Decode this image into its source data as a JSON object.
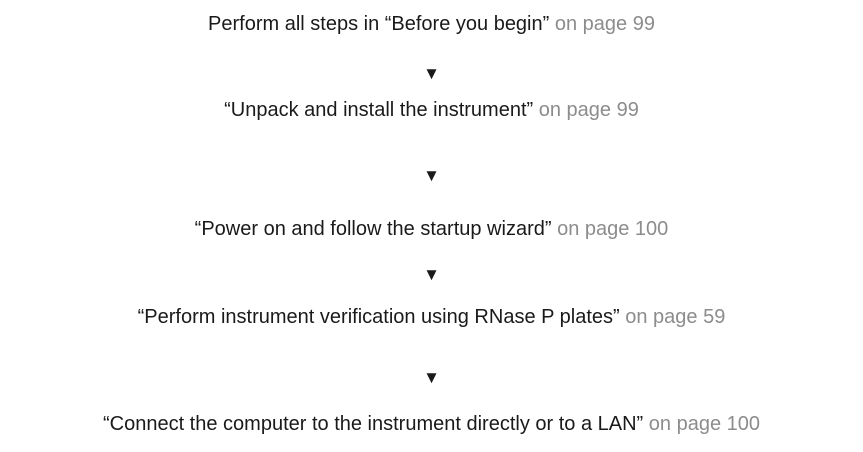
{
  "steps": [
    {
      "title": "Perform all steps in “Before you begin”",
      "ref": "on page 99"
    },
    {
      "title": "“Unpack and install the instrument”",
      "ref": "on page 99"
    },
    {
      "title": "“Power on and follow the startup wizard”",
      "ref": "on page 100"
    },
    {
      "title": "“Perform instrument verification using RNase P plates”",
      "ref": "on page 59"
    },
    {
      "title": "“Connect the computer to the instrument directly or to a LAN”",
      "ref": "on page 100"
    }
  ],
  "arrow_glyph": "▼",
  "colors": {
    "text": "#1a1a1a",
    "page_reference": "#8c8c8c",
    "background": "#ffffff"
  }
}
